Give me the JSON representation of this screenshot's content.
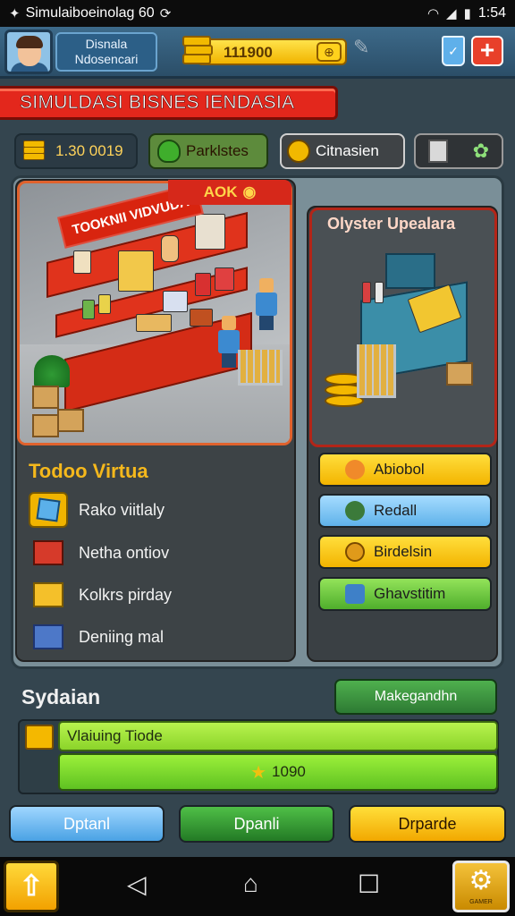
{
  "status_bar": {
    "title": "Simulaiboeinolag 60",
    "time": "1:54"
  },
  "header": {
    "player_line1": "Disnala",
    "player_line2": "Ndosencari",
    "coins": "111900"
  },
  "banner": {
    "title": "SIMULDASI BISNES IENDASIA"
  },
  "resources": {
    "coins": "1.30 0019",
    "parks": "Parklstes",
    "citizen": "Citnasien"
  },
  "store": {
    "sign": "TOOKNII VIDVUDA",
    "tag": "AOK"
  },
  "left_list": {
    "title": "Todoo Virtua",
    "items": [
      {
        "label": "Rako viitlaly"
      },
      {
        "label": "Netha  ontiov"
      },
      {
        "label": "Kolkrs pirday"
      },
      {
        "label": "Deniing mal"
      }
    ]
  },
  "upgrade": {
    "title": "Olyster Upealara"
  },
  "actions": [
    {
      "label": "Abiobol"
    },
    {
      "label": "Redall"
    },
    {
      "label": "Birdelsin"
    },
    {
      "label": "Ghavstitim"
    }
  ],
  "system": {
    "title": "Sydaian",
    "manage_label": "Makegandhn",
    "progress_label": "Vlaiuing Tiode",
    "progress_value": "1090"
  },
  "bottom_buttons": [
    {
      "label": "Dptanl"
    },
    {
      "label": "Dpanli"
    },
    {
      "label": "Drparde"
    }
  ],
  "nav": {
    "settings_caption": "GAMER"
  },
  "colors": {
    "banner_red": "#e3271c",
    "gold": "#f3b400",
    "panel": "#3d4346"
  }
}
